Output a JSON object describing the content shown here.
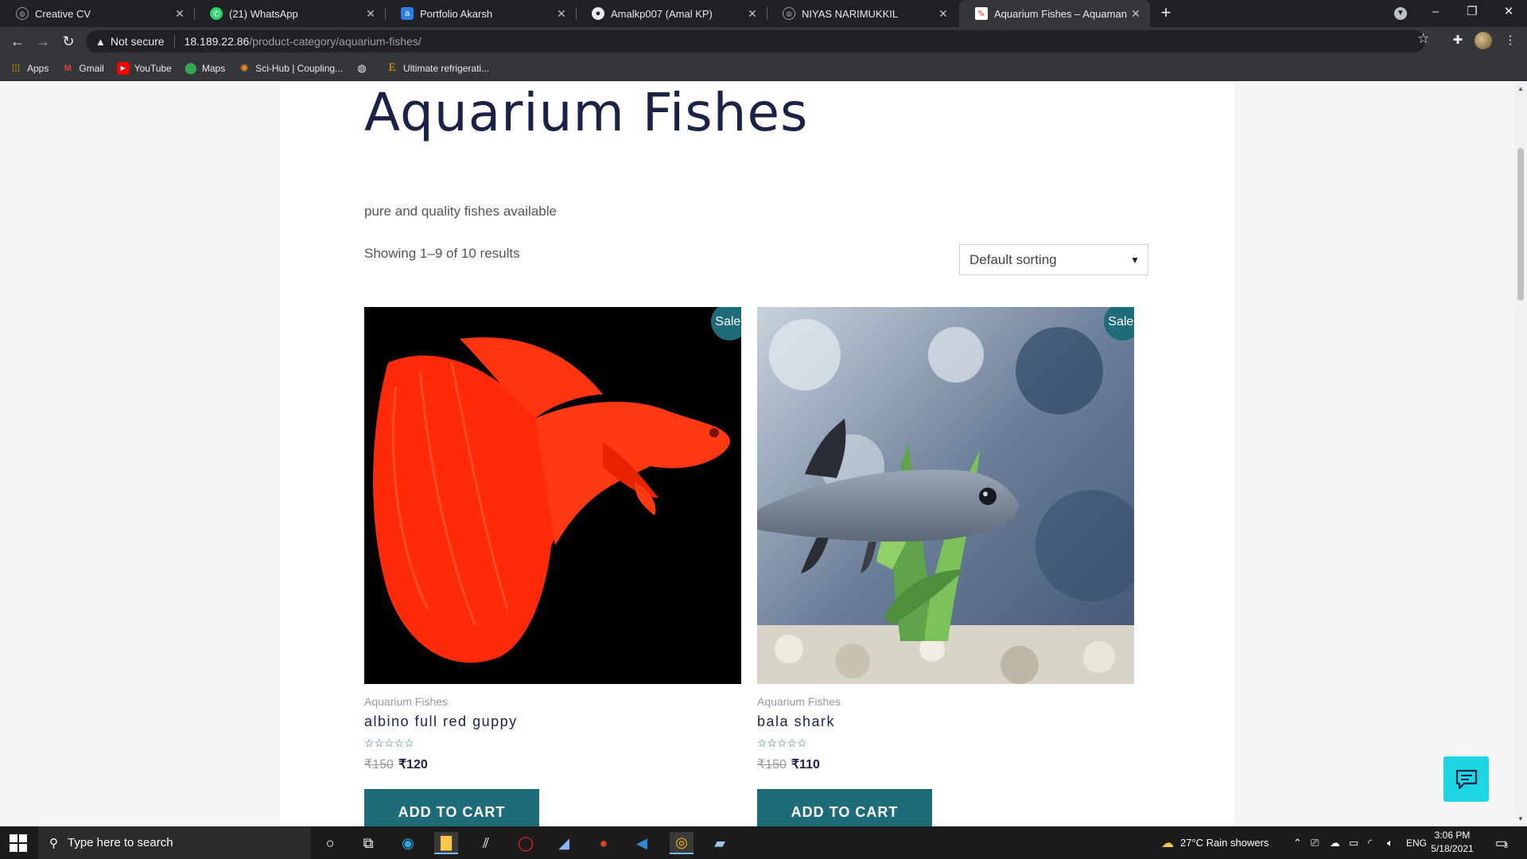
{
  "browser": {
    "tabs": [
      {
        "title": "Creative CV",
        "icon": "globe-icon",
        "active": false
      },
      {
        "title": "(21) WhatsApp",
        "icon": "whatsapp-icon",
        "active": false
      },
      {
        "title": "Portfolio Akarsh",
        "icon": "site-icon",
        "active": false
      },
      {
        "title": "Amalkp007 (Amal KP)",
        "icon": "github-icon",
        "active": false
      },
      {
        "title": "NIYAS NARIMUKKIL",
        "icon": "globe-icon",
        "active": false
      },
      {
        "title": "Aquarium Fishes – Aquaman",
        "icon": "site-icon",
        "active": true
      }
    ],
    "address": {
      "security_label": "Not secure",
      "host": "18.189.22.86",
      "path": "/product-category/aquarium-fishes/"
    },
    "bookmarks": [
      {
        "label": "Apps",
        "icon": "apps-grid-icon"
      },
      {
        "label": "Gmail",
        "icon": "gmail-icon"
      },
      {
        "label": "YouTube",
        "icon": "youtube-icon"
      },
      {
        "label": "Maps",
        "icon": "maps-icon"
      },
      {
        "label": "Sci-Hub | Coupling...",
        "icon": "scihub-icon"
      },
      {
        "label": "",
        "icon": "globe-icon"
      },
      {
        "label": "Ultimate refrigerati...",
        "icon": "e-icon"
      }
    ]
  },
  "page": {
    "title": "Aquarium Fishes",
    "description": "pure and quality fishes available",
    "result_count": "Showing 1–9 of 10 results",
    "sort": {
      "selected": "Default sorting"
    },
    "products": [
      {
        "badge": "Sale!",
        "category": "Aquarium Fishes",
        "name": "albino full red guppy",
        "stars": "☆☆☆☆☆",
        "rating": 0,
        "old_price": "₹150",
        "new_price": "₹120",
        "button": "ADD TO CART"
      },
      {
        "badge": "Sale!",
        "category": "Aquarium Fishes",
        "name": "bala shark",
        "stars": "☆☆☆☆☆",
        "rating": 0,
        "old_price": "₹150",
        "new_price": "₹110",
        "button": "ADD TO CART"
      }
    ]
  },
  "taskbar": {
    "search_placeholder": "Type here to search",
    "weather": "27°C  Rain showers",
    "language": "ENG",
    "time": "3:06 PM",
    "date": "5/18/2021",
    "notifications": "3"
  },
  "colors": {
    "accent": "#1e6b7a",
    "heading": "#1b2248",
    "chat": "#1dd6e2"
  }
}
